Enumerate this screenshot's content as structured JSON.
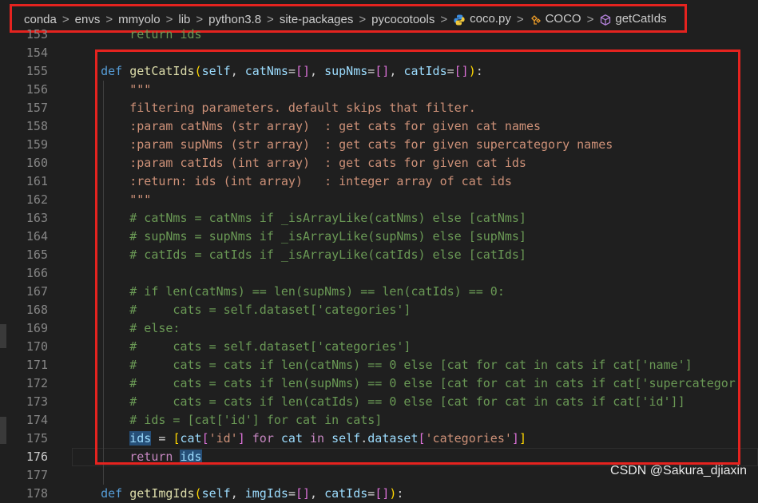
{
  "breadcrumb": {
    "items": [
      "conda",
      "envs",
      "mmyolo",
      "lib",
      "python3.8",
      "site-packages",
      "pycocotools"
    ],
    "file": "coco.py",
    "class_name": "COCO",
    "method_name": "getCatIds",
    "separator": ">"
  },
  "editor": {
    "lines": [
      {
        "n": "153",
        "html": "<span class=\"cm\">        return ids</span>"
      },
      {
        "n": "154",
        "html": ""
      },
      {
        "n": "155",
        "html": "    <span class=\"kw\">def</span> <span class=\"fn\">getCatIds</span><span class=\"br\">(</span><span class=\"par\">self</span>, <span class=\"par\">catNms</span>=<span class=\"br2\">[]</span>, <span class=\"par\">supNms</span>=<span class=\"br2\">[]</span>, <span class=\"par\">catIds</span>=<span class=\"br2\">[]</span><span class=\"br\">)</span>:"
      },
      {
        "n": "156",
        "html": "        <span class=\"str\">\"\"\"</span>"
      },
      {
        "n": "157",
        "html": "<span class=\"str\">        filtering parameters. default skips that filter.</span>"
      },
      {
        "n": "158",
        "html": "<span class=\"str\">        :param catNms (str array)  : get cats for given cat names</span>"
      },
      {
        "n": "159",
        "html": "<span class=\"str\">        :param supNms (str array)  : get cats for given supercategory names</span>"
      },
      {
        "n": "160",
        "html": "<span class=\"str\">        :param catIds (int array)  : get cats for given cat ids</span>"
      },
      {
        "n": "161",
        "html": "<span class=\"str\">        :return: ids (int array)   : integer array of cat ids</span>"
      },
      {
        "n": "162",
        "html": "<span class=\"str\">        \"\"\"</span>"
      },
      {
        "n": "163",
        "html": "<span class=\"cm\">        # catNms = catNms if _isArrayLike(catNms) else [catNms]</span>"
      },
      {
        "n": "164",
        "html": "<span class=\"cm\">        # supNms = supNms if _isArrayLike(supNms) else [supNms]</span>"
      },
      {
        "n": "165",
        "html": "<span class=\"cm\">        # catIds = catIds if _isArrayLike(catIds) else [catIds]</span>"
      },
      {
        "n": "166",
        "html": ""
      },
      {
        "n": "167",
        "html": "<span class=\"cm\">        # if len(catNms) == len(supNms) == len(catIds) == 0:</span>"
      },
      {
        "n": "168",
        "html": "<span class=\"cm\">        #     cats = self.dataset['categories']</span>"
      },
      {
        "n": "169",
        "html": "<span class=\"cm\">        # else:</span>"
      },
      {
        "n": "170",
        "html": "<span class=\"cm\">        #     cats = self.dataset['categories']</span>"
      },
      {
        "n": "171",
        "html": "<span class=\"cm\">        #     cats = cats if len(catNms) == 0 else [cat for cat in cats if cat['name']</span>"
      },
      {
        "n": "172",
        "html": "<span class=\"cm\">        #     cats = cats if len(supNms) == 0 else [cat for cat in cats if cat['supercategor</span>"
      },
      {
        "n": "173",
        "html": "<span class=\"cm\">        #     cats = cats if len(catIds) == 0 else [cat for cat in cats if cat['id']]</span>"
      },
      {
        "n": "174",
        "html": "<span class=\"cm\">        # ids = [cat['id'] for cat in cats]</span>"
      },
      {
        "n": "175",
        "html": "        <span class=\"par hl\">ids</span> = <span class=\"br\">[</span><span class=\"par\">cat</span><span class=\"br2\">[</span><span class=\"str\">'id'</span><span class=\"br2\">]</span> <span class=\"ctrl\">for</span> <span class=\"par\">cat</span> <span class=\"ctrl\">in</span> <span class=\"par\">self</span>.<span class=\"par\">dataset</span><span class=\"br2\">[</span><span class=\"str\">'categories'</span><span class=\"br2\">]</span><span class=\"br\">]</span>"
      },
      {
        "n": "176",
        "html": "        <span class=\"ctrl\">return</span> <span class=\"par hl\">ids</span>"
      },
      {
        "n": "177",
        "html": ""
      },
      {
        "n": "178",
        "html": "    <span class=\"kw\">def</span> <span class=\"fn\">getImgIds</span><span class=\"br\">(</span><span class=\"par\">self</span>, <span class=\"par\">imgIds</span>=<span class=\"br2\">[]</span>, <span class=\"par\">catIds</span>=<span class=\"br2\">[]</span><span class=\"br\">)</span>:"
      }
    ]
  },
  "watermark": "CSDN @Sakura_djiaxin"
}
